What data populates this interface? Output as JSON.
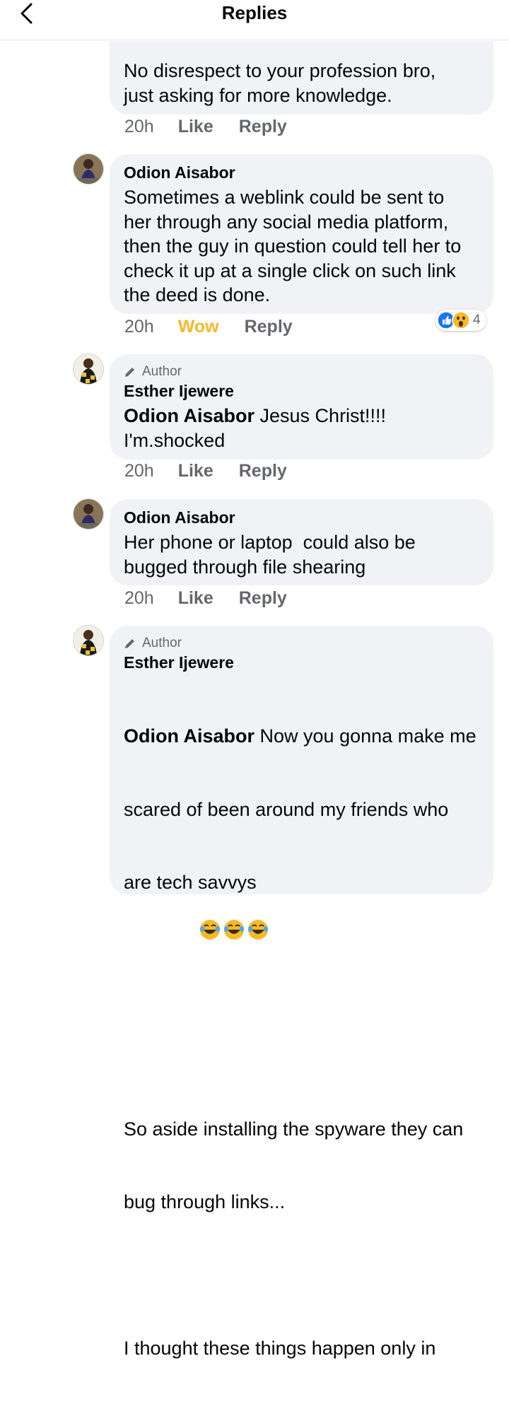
{
  "header": {
    "title": "Replies"
  },
  "comments": [
    {
      "text": "No disrespect to your profession bro,\njust asking for more knowledge.",
      "time": "20h",
      "like": "Like",
      "reply": "Reply"
    },
    {
      "name": "Odion Aisabor",
      "text": "Sometimes a weblink could be sent to\nher through any social media platform,\nthen the guy in question could tell her to\ncheck it up at a single click on such link\nthe deed is done.",
      "time": "20h",
      "reaction_label": "Wow",
      "reply": "Reply",
      "reactions": {
        "count": "4",
        "types": [
          "like-icon",
          "wow-icon"
        ]
      }
    },
    {
      "author_badge": "Author",
      "name": "Esther Ijewere",
      "mention": "Odion Aisabor",
      "text": " Jesus Christ!!!!\nI'm.shocked",
      "time": "20h",
      "like": "Like",
      "reply": "Reply"
    },
    {
      "name": "Odion Aisabor",
      "text": "Her phone or laptop  could also be\nbugged through file shearing",
      "time": "20h",
      "like": "Like",
      "reply": "Reply"
    },
    {
      "author_badge": "Author",
      "name": "Esther Ijewere",
      "mention": "Odion Aisabor",
      "line1": " Now you gonna make me",
      "line2": "scared of been around my friends who",
      "line3": "are tech savvys",
      "line4": "So aside installing the spyware they can",
      "line5": "bug through links...",
      "line6": "I thought these things happen only in"
    }
  ],
  "colors": {
    "wow": "#f7b928",
    "meta": "#65676b",
    "bubble": "#f0f2f5",
    "like_blue": "#1877f2"
  }
}
